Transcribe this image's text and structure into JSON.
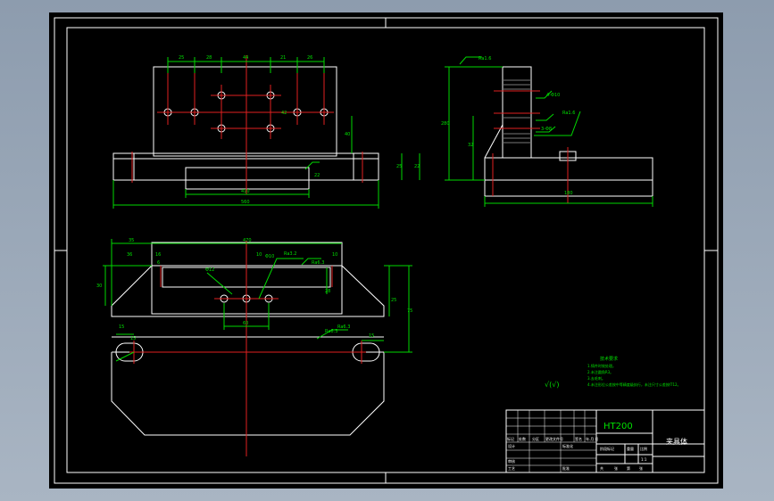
{
  "dimensions": {
    "top_view": [
      "25",
      "28",
      "44",
      "21",
      "26",
      "40",
      "22",
      "25",
      "22",
      "42"
    ],
    "top_view_width": [
      "410",
      "560"
    ],
    "side_view": [
      "Ra1.6",
      "280",
      "32",
      "180",
      "Ra1.6",
      "4-Φ10",
      "3-Φ8"
    ],
    "plan_view": [
      "35",
      "470",
      "36",
      "16",
      "10",
      "Ra3.2",
      "Ra6.3",
      "Φ12",
      "Ra6.3",
      "25",
      "10",
      "30",
      "28",
      "75",
      "15",
      "15",
      "15",
      "60",
      "Ra6.3",
      "Φ10",
      "6"
    ]
  },
  "notes": {
    "heading": "技术要求",
    "lines": [
      "1.铸件时效处理。",
      "2.未注圆角R3。",
      "3.去毛刺。",
      "4.未注形位公差按中等精度级执行，未注尺寸公差按IT12。"
    ],
    "roughness_symbol": "√(√)"
  },
  "title_block": {
    "material": "HT200",
    "part_name": "夹具体",
    "scale": "1:1",
    "col_labels": [
      "标记",
      "处数",
      "分区",
      "更改文件号",
      "签名",
      "年.月.日"
    ],
    "row_labels": [
      "设计",
      "审核",
      "工艺",
      "批准"
    ],
    "mid_labels": [
      "标准化",
      "阶段标记",
      "重量",
      "比例"
    ],
    "sheet_labels": [
      "共",
      "张",
      "第",
      "张"
    ]
  }
}
